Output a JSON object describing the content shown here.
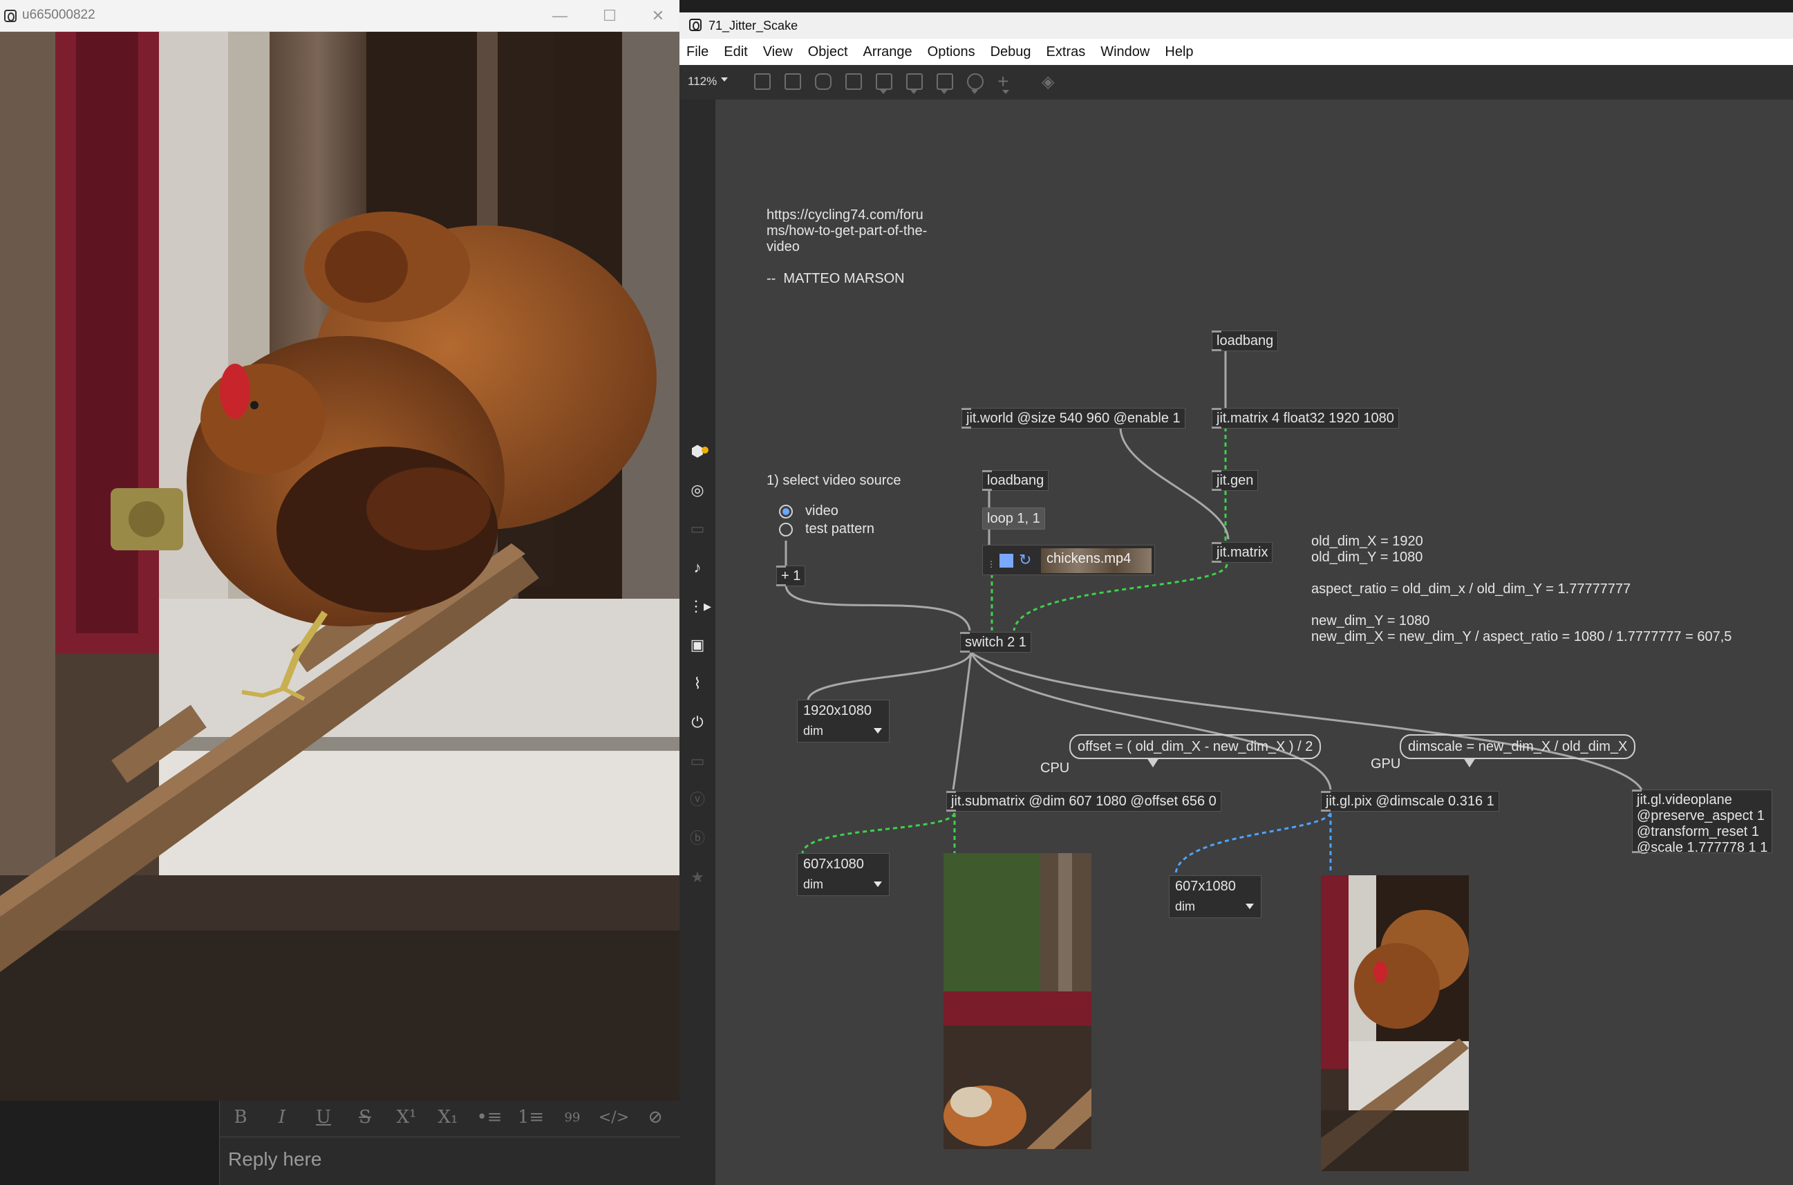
{
  "left_window": {
    "title": "u665000822",
    "reply": {
      "placeholder": "Reply here",
      "toolbar": [
        "B",
        "I",
        "U",
        "S",
        "X¹",
        "X₁",
        "•≡",
        "1≡",
        "99",
        "</>",
        "⊘"
      ]
    }
  },
  "right_window": {
    "title": "71_Jitter_Scake",
    "menu": [
      "File",
      "Edit",
      "View",
      "Object",
      "Arrange",
      "Options",
      "Debug",
      "Extras",
      "Window",
      "Help"
    ],
    "zoom": "112%",
    "sidebar_icons": [
      "cube-icon",
      "target-icon",
      "film-icon",
      "music-icon",
      "sequence-icon",
      "image-icon",
      "paperclip-icon",
      "plug-icon",
      "plugin-icon",
      "v-icon",
      "b-icon",
      "star-icon"
    ],
    "patch": {
      "url_comment": "https://cycling74.com/foru\nms/how-to-get-part-of-the-\nvideo\n\n--  MATTEO MARSON",
      "select_label": "1) select video source",
      "radio_options": [
        "video",
        "test pattern"
      ],
      "math_comment": "old_dim_X = 1920\nold_dim_Y = 1080\n\naspect_ratio = old_dim_x / old_dim_Y = 1.77777777\n\nnew_dim_Y = 1080\nnew_dim_X = new_dim_Y / aspect_ratio = 1080 / 1.7777777 = 607,5",
      "objects": {
        "loadbang_top": "loadbang",
        "jit_world": "jit.world @size 540 960 @enable 1",
        "jit_matrix_float": "jit.matrix 4 float32 1920 1080",
        "jit_gen": "jit.gen",
        "jit_matrix": "jit.matrix",
        "loadbang_mid": "loadbang",
        "plus_one": "+ 1",
        "switch": "switch 2 1",
        "submatrix": "jit.submatrix @dim 607 1080 @offset 656 0",
        "gl_pix": "jit.gl.pix @dimscale 0.316 1",
        "videoplane": "jit.gl.videoplane\n@preserve_aspect 1\n@transform_reset 1\n@scale 1.777778 1 1"
      },
      "messages": {
        "loop": "loop 1, 1"
      },
      "player": {
        "file": "chickens.mp4"
      },
      "bubbles": {
        "offset": "offset = ( old_dim_X - new_dim_X ) / 2",
        "dimscale": "dimscale = new_dim_X / old_dim_X"
      },
      "labels": {
        "cpu": "CPU",
        "gpu": "GPU"
      },
      "dim_boxes": [
        {
          "value": "1920x1080",
          "label": "dim"
        },
        {
          "value": "607x1080",
          "label": "dim"
        },
        {
          "value": "607x1080",
          "label": "dim"
        }
      ]
    }
  },
  "colors": {
    "patch_bg": "#3f3f3f",
    "cable_gray": "#a8a8a8",
    "cable_green": "#3ed14a",
    "cable_blue": "#4da3ff",
    "radio_on": "#6aa7ff"
  }
}
